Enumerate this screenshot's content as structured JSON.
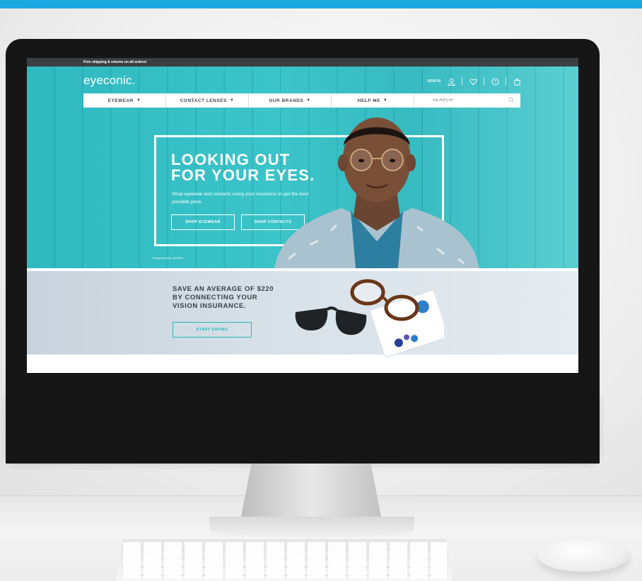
{
  "site": {
    "promo": "Free shipping & returns on all orders!",
    "logo": "eyeconic.",
    "header": {
      "sign_in": "SIGN IN"
    },
    "nav": {
      "items": [
        {
          "label": "EYEWEAR"
        },
        {
          "label": "CONTACT LENSES"
        },
        {
          "label": "OUR BRANDS"
        },
        {
          "label": "HELP ME"
        }
      ],
      "search_placeholder": "SEARCH"
    },
    "hero": {
      "headline_line1": "LOOKING OUT",
      "headline_line2": "FOR YOUR EYES.",
      "subtext": "Shop eyewear and contacts using your insurance to get the best possible price.",
      "btn_eyewear": "SHOP EYEWEAR",
      "btn_contacts": "SHOP CONTACTS",
      "caption": "Featured Style: OO5451"
    },
    "savings": {
      "line1": "SAVE AN AVERAGE OF $220",
      "line2": "BY CONNECTING YOUR",
      "line3": "VISION INSURANCE.",
      "cta": "START SAVING"
    },
    "colors": {
      "brand_teal": "#2fb8bf",
      "dark_gray": "#3b3f44",
      "top_strip": "#19a8e0"
    }
  }
}
